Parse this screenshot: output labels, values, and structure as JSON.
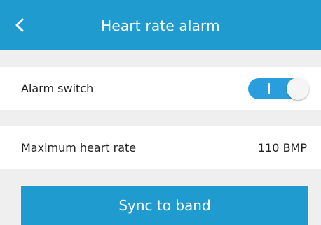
{
  "header": {
    "title": "Heart rate alarm",
    "back_icon": "chevron-left-icon"
  },
  "alarm": {
    "label": "Alarm switch",
    "enabled": true
  },
  "max_heart_rate": {
    "label": "Maximum heart rate",
    "value": "110 BMP"
  },
  "actions": {
    "sync_label": "Sync to band"
  },
  "colors": {
    "accent": "#1f9bd0",
    "background": "#efefef",
    "row_background": "#ffffff"
  }
}
